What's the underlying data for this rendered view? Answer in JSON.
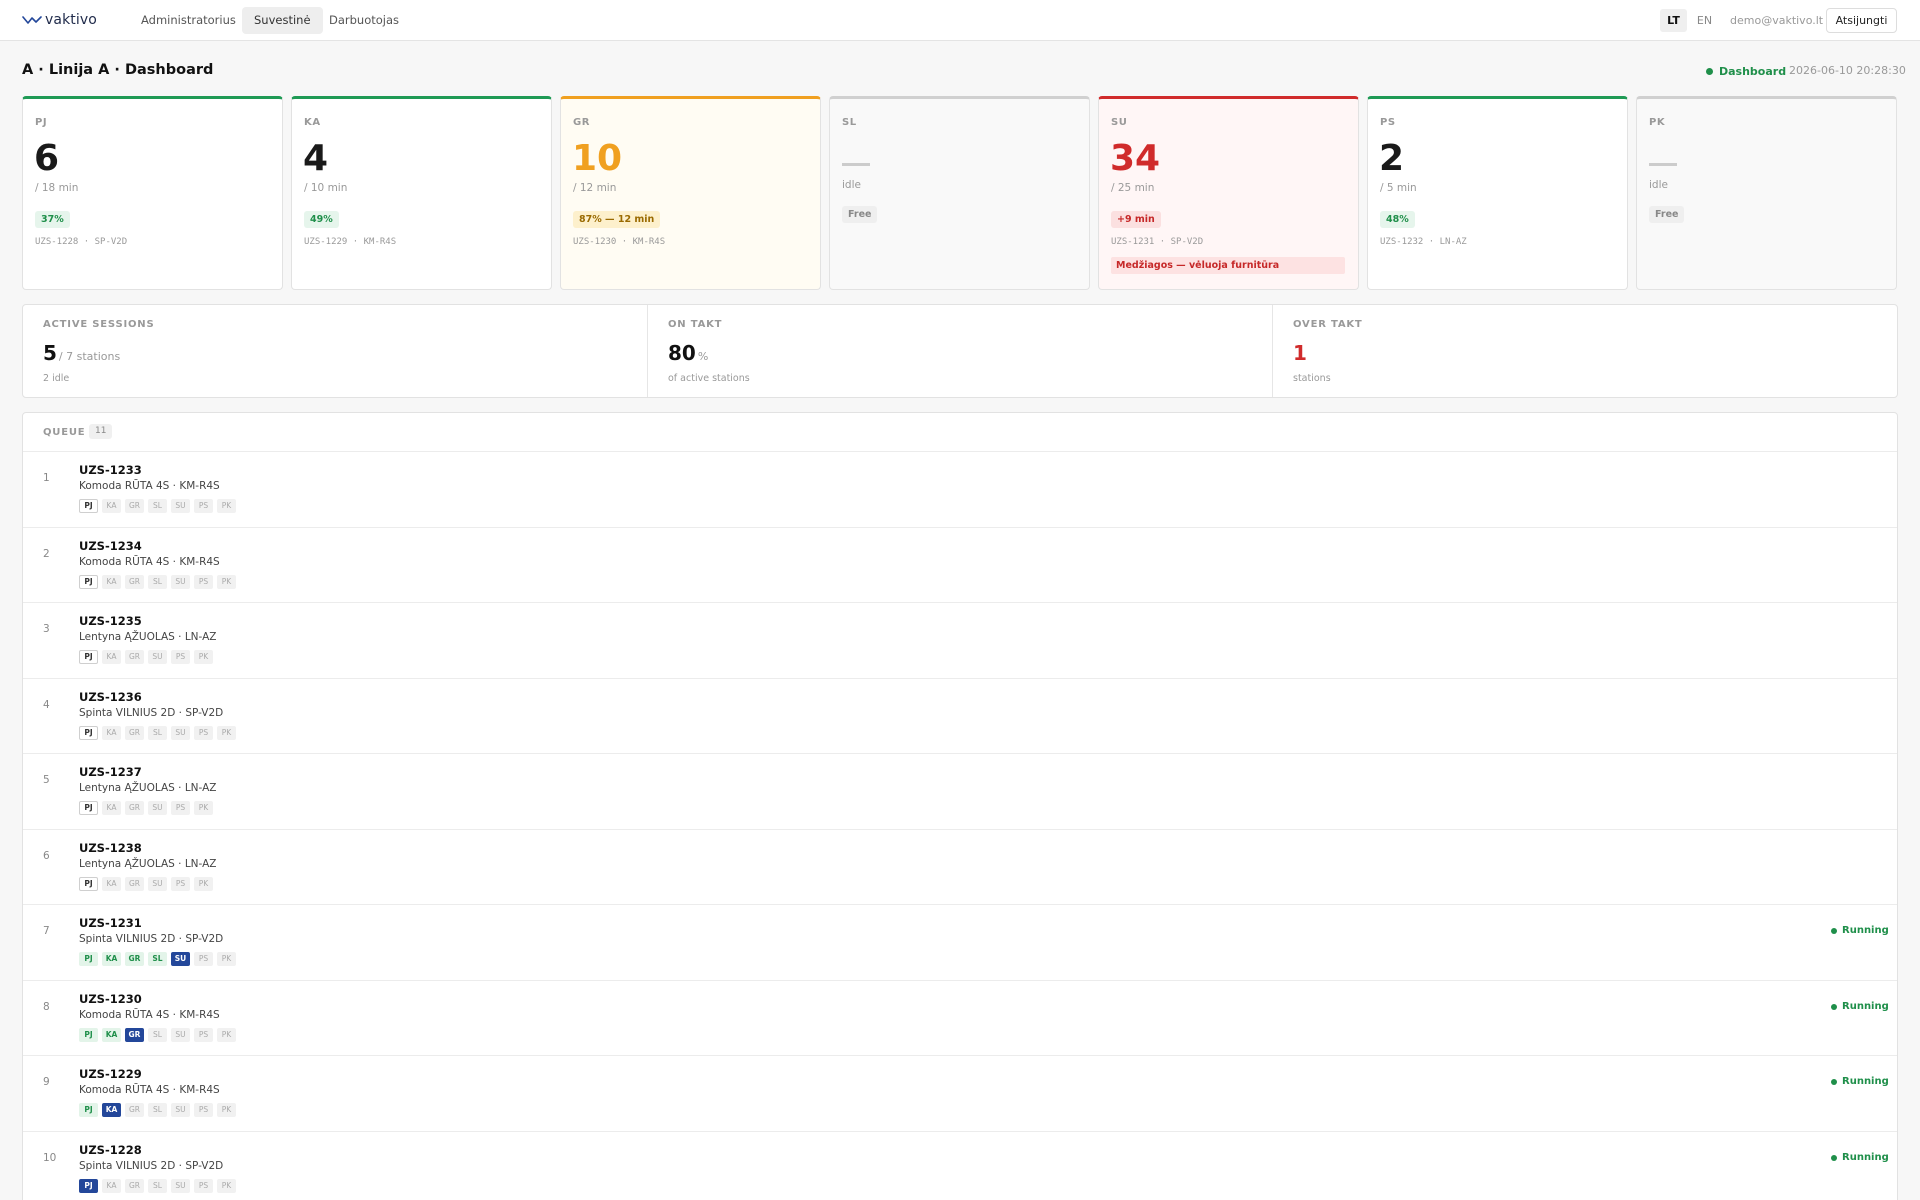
{
  "nav": {
    "logo_text": "vaktivo",
    "tabs": [
      "Administratorius",
      "Suvestinė",
      "Darbuotojas"
    ],
    "lang_lt": "LT",
    "lang_en": "EN",
    "email": "demo@vaktivo.lt",
    "logout": "Atsijungti"
  },
  "header": {
    "title": "A · Linija A  ·  Dashboard",
    "status_label": "Dashboard",
    "timestamp": "2026-06-10 20:28:30"
  },
  "stations": [
    {
      "code": "PJ",
      "value": "6",
      "takt": "/ 18 min",
      "badge": "37%",
      "order": "UZS-1228",
      "model": "SP-V2D",
      "state": "ok"
    },
    {
      "code": "KA",
      "value": "4",
      "takt": "/ 10 min",
      "badge": "49%",
      "order": "UZS-1229",
      "model": "KM-R4S",
      "state": "ok"
    },
    {
      "code": "GR",
      "value": "10",
      "takt": "/ 12 min",
      "badge": "87% — 12 min",
      "order": "UZS-1230",
      "model": "KM-R4S",
      "state": "warning"
    },
    {
      "code": "SL",
      "idle": "idle",
      "badge": "Free",
      "state": "idle"
    },
    {
      "code": "SU",
      "value": "34",
      "takt": "/ 25 min",
      "badge": "+9 min",
      "order": "UZS-1231",
      "model": "SP-V2D",
      "alert": "Medžiagos — vėluoja furnitūra",
      "state": "over"
    },
    {
      "code": "PS",
      "value": "2",
      "takt": "/ 5 min",
      "badge": "48%",
      "order": "UZS-1232",
      "model": "LN-AZ",
      "state": "ok"
    },
    {
      "code": "PK",
      "idle": "idle",
      "badge": "Free",
      "state": "idle"
    }
  ],
  "summary": {
    "active_sessions": {
      "label": "ACTIVE SESSIONS",
      "value": "5",
      "unit": "/ 7 stations",
      "sub": "2 idle"
    },
    "on_takt": {
      "label": "ON TAKT",
      "value": "80",
      "unit": "%",
      "sub": "of active stations"
    },
    "over_takt": {
      "label": "OVER TAKT",
      "value": "1",
      "unit": "",
      "sub": "stations"
    }
  },
  "queue": {
    "title": "QUEUE",
    "count": "11",
    "station_codes": [
      "PJ",
      "KA",
      "GR",
      "SL",
      "SU",
      "PS",
      "PK"
    ],
    "running_label": "Running",
    "rows": [
      {
        "index": "1",
        "order": "UZS-1233",
        "product": "Komoda RŪTA 4S · KM-R4S",
        "stations": [
          "PJ",
          "KA",
          "GR",
          "SL",
          "SU",
          "PS",
          "PK"
        ],
        "states": [
          "next",
          "pending",
          "pending",
          "pending",
          "pending",
          "pending",
          "pending"
        ],
        "running": false
      },
      {
        "index": "2",
        "order": "UZS-1234",
        "product": "Komoda RŪTA 4S · KM-R4S",
        "stations": [
          "PJ",
          "KA",
          "GR",
          "SL",
          "SU",
          "PS",
          "PK"
        ],
        "states": [
          "next",
          "pending",
          "pending",
          "pending",
          "pending",
          "pending",
          "pending"
        ],
        "running": false
      },
      {
        "index": "3",
        "order": "UZS-1235",
        "product": "Lentyna ĄŽUOLAS · LN-AZ",
        "stations": [
          "PJ",
          "KA",
          "GR",
          "SU",
          "PS",
          "PK"
        ],
        "states": [
          "next",
          "pending",
          "pending",
          "pending",
          "pending",
          "pending"
        ],
        "running": false
      },
      {
        "index": "4",
        "order": "UZS-1236",
        "product": "Spinta VILNIUS 2D · SP-V2D",
        "stations": [
          "PJ",
          "KA",
          "GR",
          "SL",
          "SU",
          "PS",
          "PK"
        ],
        "states": [
          "next",
          "pending",
          "pending",
          "pending",
          "pending",
          "pending",
          "pending"
        ],
        "running": false
      },
      {
        "index": "5",
        "order": "UZS-1237",
        "product": "Lentyna ĄŽUOLAS · LN-AZ",
        "stations": [
          "PJ",
          "KA",
          "GR",
          "SU",
          "PS",
          "PK"
        ],
        "states": [
          "next",
          "pending",
          "pending",
          "pending",
          "pending",
          "pending"
        ],
        "running": false
      },
      {
        "index": "6",
        "order": "UZS-1238",
        "product": "Lentyna ĄŽUOLAS · LN-AZ",
        "stations": [
          "PJ",
          "KA",
          "GR",
          "SU",
          "PS",
          "PK"
        ],
        "states": [
          "next",
          "pending",
          "pending",
          "pending",
          "pending",
          "pending"
        ],
        "running": false
      },
      {
        "index": "7",
        "order": "UZS-1231",
        "product": "Spinta VILNIUS 2D · SP-V2D",
        "stations": [
          "PJ",
          "KA",
          "GR",
          "SL",
          "SU",
          "PS",
          "PK"
        ],
        "states": [
          "done",
          "done",
          "done",
          "done",
          "current",
          "pending",
          "pending"
        ],
        "running": true
      },
      {
        "index": "8",
        "order": "UZS-1230",
        "product": "Komoda RŪTA 4S · KM-R4S",
        "stations": [
          "PJ",
          "KA",
          "GR",
          "SL",
          "SU",
          "PS",
          "PK"
        ],
        "states": [
          "done",
          "done",
          "current",
          "pending",
          "pending",
          "pending",
          "pending"
        ],
        "running": true
      },
      {
        "index": "9",
        "order": "UZS-1229",
        "product": "Komoda RŪTA 4S · KM-R4S",
        "stations": [
          "PJ",
          "KA",
          "GR",
          "SL",
          "SU",
          "PS",
          "PK"
        ],
        "states": [
          "done",
          "current",
          "pending",
          "pending",
          "pending",
          "pending",
          "pending"
        ],
        "running": true
      },
      {
        "index": "10",
        "order": "UZS-1228",
        "product": "Spinta VILNIUS 2D · SP-V2D",
        "stations": [
          "PJ",
          "KA",
          "GR",
          "SL",
          "SU",
          "PS",
          "PK"
        ],
        "states": [
          "current",
          "pending",
          "pending",
          "pending",
          "pending",
          "pending",
          "pending"
        ],
        "running": true
      }
    ]
  },
  "colors": {
    "ok": "#1f9a55",
    "warning": "#f0a020",
    "over": "#d02b2b",
    "idle": "#d0d0d0",
    "current_chip": "#23479a"
  },
  "icons": {
    "logo": "vaktivo-wave-logo-icon",
    "live_status": "green-dot-icon",
    "running": "green-dot-icon"
  }
}
